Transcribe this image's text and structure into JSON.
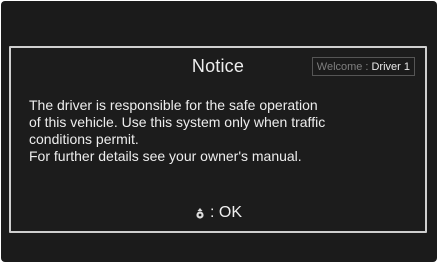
{
  "notice": {
    "title": "Notice",
    "welcome_label": "Welcome",
    "welcome_sep": ":",
    "welcome_driver": "Driver 1",
    "message_lines": [
      "The driver is responsible for the safe operation",
      "of this vehicle. Use this system only when traffic",
      "conditions permit.",
      "For further details see your owner's manual."
    ],
    "ok_label": ": OK",
    "ok_icon": "interface-dial-icon"
  }
}
